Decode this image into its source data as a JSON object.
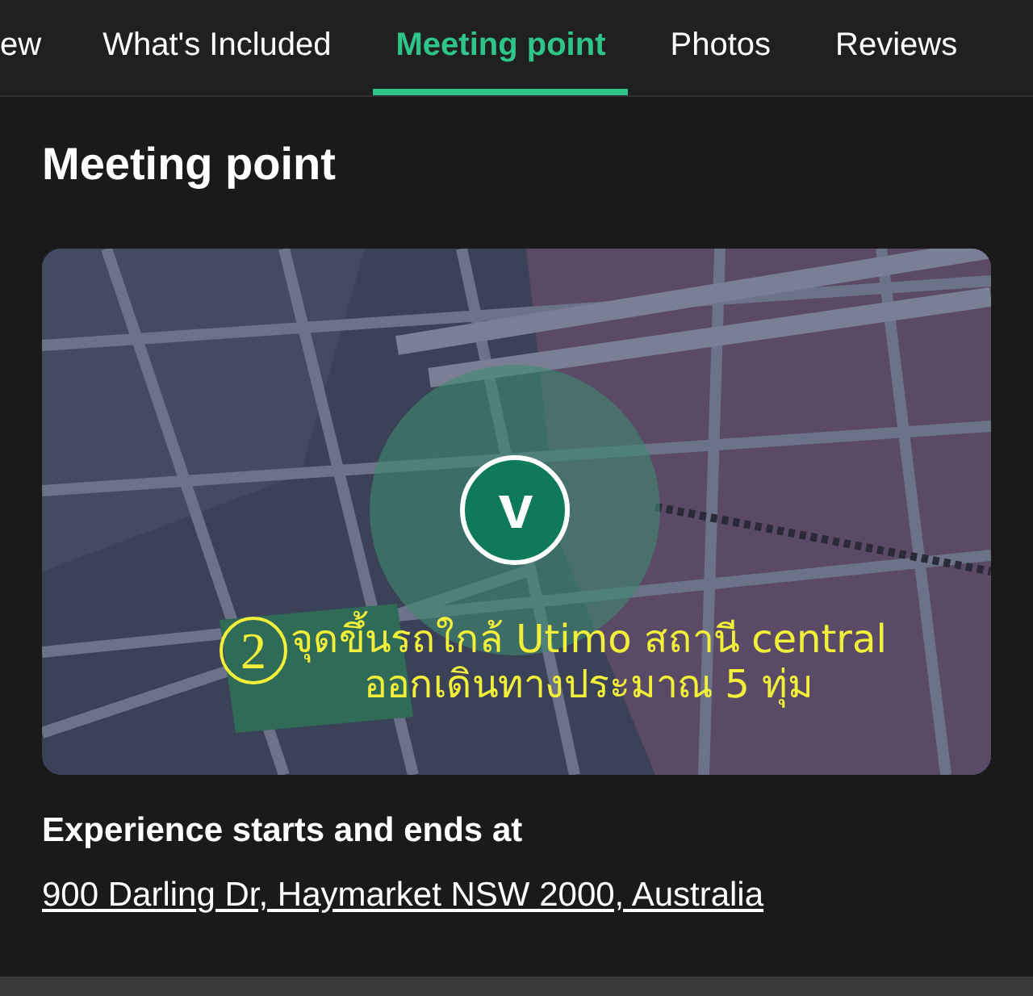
{
  "tabs": [
    {
      "label": "ew",
      "selected": false
    },
    {
      "label": "What's Included",
      "selected": false
    },
    {
      "label": "Meeting point",
      "selected": true
    },
    {
      "label": "Photos",
      "selected": false
    },
    {
      "label": "Reviews",
      "selected": false
    }
  ],
  "section": {
    "title": "Meeting point",
    "map": {
      "kind": "picture",
      "annotation": {
        "mark": "2",
        "lines": [
          "จุดขึ้นรถใกล้ Utimo สถานี central",
          "ออกเดินทางประมาณ 5 ทุ่ม"
        ]
      }
    },
    "subtitle": "Experience starts and ends at",
    "address": "900 Darling Dr, Haymarket NSW 2000, Australia"
  }
}
